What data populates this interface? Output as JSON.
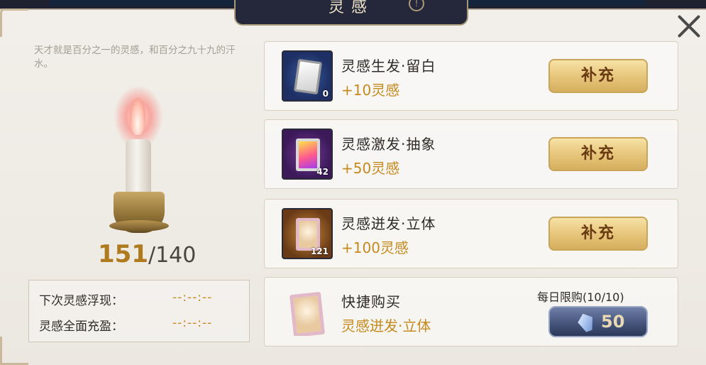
{
  "window": {
    "title": "灵感",
    "info_icon": "info-icon",
    "close_icon": "close-icon"
  },
  "left": {
    "quote": "天才就是百分之一的灵感，和百分之九十九的汗水。",
    "inspiration": {
      "current": "151",
      "slash": "/",
      "max": "140"
    },
    "timers": [
      {
        "label": "下次灵感浮现：",
        "value": "--:--:--"
      },
      {
        "label": "灵感全面充盈：",
        "value": "--:--:--"
      }
    ]
  },
  "items": [
    {
      "name": "灵感生发·留白",
      "gain": "+10灵感",
      "quantity": "0",
      "button": "补充",
      "color": "#1d2f64"
    },
    {
      "name": "灵感激发·抽象",
      "gain": "+50灵感",
      "quantity": "42",
      "button": "补充",
      "color": "#3c1a5a"
    },
    {
      "name": "灵感迸发·立体",
      "gain": "+100灵感",
      "quantity": "121",
      "button": "补充",
      "color": "#6a3a16"
    }
  ],
  "quick_buy": {
    "name": "快捷购买",
    "item": "灵感迸发·立体",
    "limit": "每日限购(10/10)",
    "price": "50",
    "currency_icon": "feather-gem-icon"
  }
}
